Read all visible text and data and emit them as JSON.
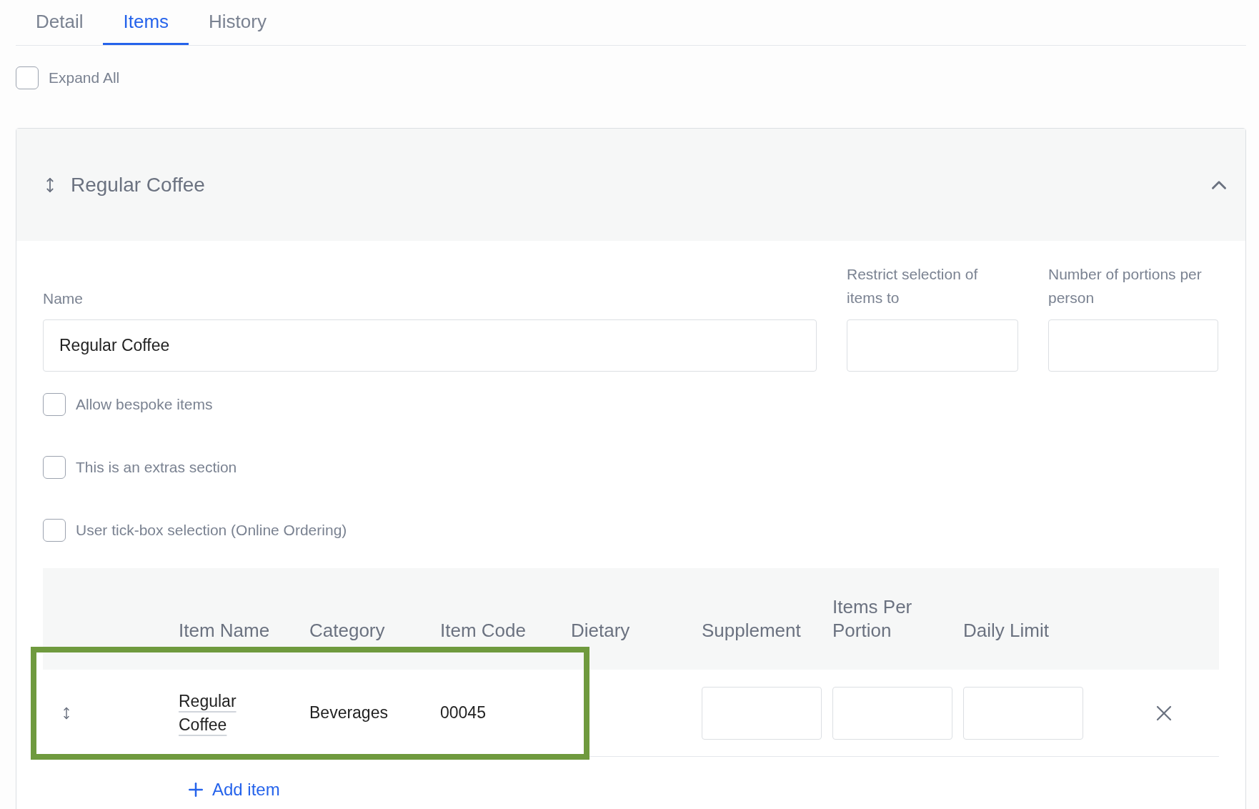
{
  "tabs": [
    {
      "label": "Detail",
      "selected": false
    },
    {
      "label": "Items",
      "selected": true
    },
    {
      "label": "History",
      "selected": false
    }
  ],
  "expand_all": {
    "label": "Expand All",
    "checked": false
  },
  "section": {
    "title": "Regular Coffee",
    "expanded": true,
    "name_field": {
      "label": "Name",
      "value": "Regular Coffee"
    },
    "restrict_field": {
      "label": "Restrict selection of items to"
    },
    "portions_field": {
      "label": "Number of portions per person"
    },
    "options": [
      {
        "label": "Allow bespoke items",
        "checked": false
      },
      {
        "label": "This is an extras section",
        "checked": false
      },
      {
        "label": "User tick-box selection (Online Ordering)",
        "checked": false
      }
    ],
    "table": {
      "columns": [
        "Item Name",
        "Category",
        "Item Code",
        "Dietary",
        "Supplement",
        "Items Per Portion",
        "Daily Limit"
      ],
      "rows": [
        {
          "item_name": "Regular Coffee",
          "category": "Beverages",
          "item_code": "00045",
          "highlighted": true
        }
      ]
    },
    "add_item": "Add item"
  }
}
